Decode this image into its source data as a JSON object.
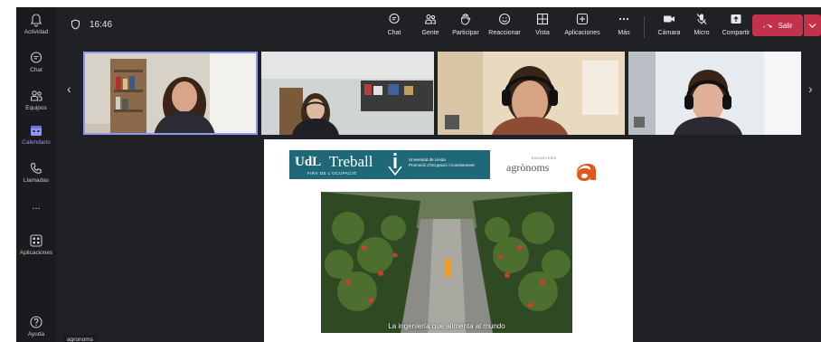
{
  "rail": {
    "items": [
      {
        "label": "Actividad",
        "icon": "bell-icon"
      },
      {
        "label": "Chat",
        "icon": "chat-icon"
      },
      {
        "label": "Equipos",
        "icon": "teams-icon"
      },
      {
        "label": "Calendario",
        "icon": "calendar-icon"
      },
      {
        "label": "Llamadas",
        "icon": "phone-icon"
      },
      {
        "label": "...",
        "icon": "more-icon"
      },
      {
        "label": "Aplicaciones",
        "icon": "apps-icon"
      },
      {
        "label": "Ayuda",
        "icon": "help-icon"
      }
    ],
    "active_index": 3
  },
  "meeting": {
    "timer": "16:46"
  },
  "toolbar": {
    "buttons": [
      {
        "label": "Chat",
        "icon": "chat-icon"
      },
      {
        "label": "Gente",
        "icon": "people-icon"
      },
      {
        "label": "Participar",
        "icon": "raise-hand-icon"
      },
      {
        "label": "Reaccionar",
        "icon": "emoji-icon"
      },
      {
        "label": "Vista",
        "icon": "grid-icon"
      },
      {
        "label": "Aplicaciones",
        "icon": "add-app-icon"
      },
      {
        "label": "Más",
        "icon": "more-icon"
      },
      {
        "label": "Cámara",
        "icon": "camera-icon"
      },
      {
        "label": "Micro",
        "icon": "mic-off-icon"
      },
      {
        "label": "Compartir",
        "icon": "share-icon"
      }
    ],
    "leave_label": "Salir"
  },
  "slide": {
    "udl_logo": {
      "udl": "UdL",
      "treball": "Treball",
      "fira": "FIRA DE L'OCUPACIÓ",
      "university": "Universitat de Lleida",
      "university_sub": "Promoció d'Ocupació i Coneixement"
    },
    "agronoms_logo": {
      "word": "agrònoms",
      "small": "ENGINYERS"
    },
    "caption": "La ingeniería que alimenta al mundo"
  },
  "presenter_name": "agronoms",
  "colors": {
    "accent": "#8f96f5",
    "leave": "#c4314b",
    "udl_teal": "#1e6878",
    "agronoms_orange": "#e2571c"
  }
}
